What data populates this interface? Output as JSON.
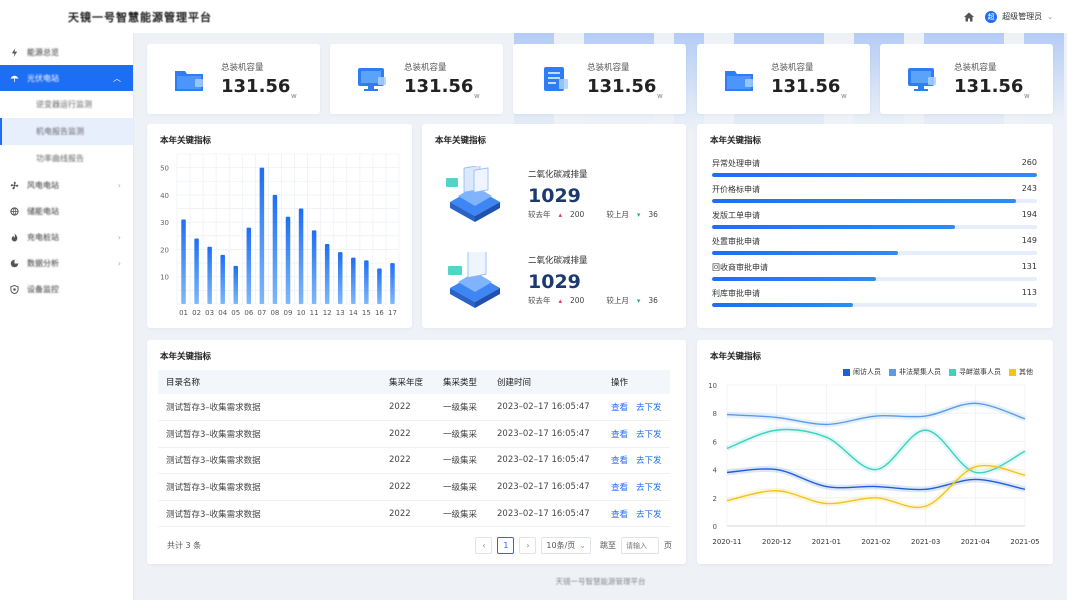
{
  "app": {
    "title": "天镜一号智慧能源管理平台",
    "user": "超级管理员",
    "avatar_letter": "超",
    "footer": "天镜一号智慧能源管理平台"
  },
  "sidebar": {
    "items": [
      {
        "label": "能源总览",
        "icon": "bolt-icon",
        "expandable": false
      },
      {
        "label": "光伏电站",
        "icon": "umbrella-icon",
        "expandable": true,
        "active": true,
        "children": [
          {
            "label": "逆变器运行监测"
          },
          {
            "label": "机电报告监测",
            "active": true
          },
          {
            "label": "功率曲线报告"
          }
        ]
      },
      {
        "label": "风电电站",
        "icon": "fan-icon",
        "expandable": true
      },
      {
        "label": "储能电站",
        "icon": "globe-icon",
        "expandable": false
      },
      {
        "label": "充电桩站",
        "icon": "flame-icon",
        "expandable": true
      },
      {
        "label": "数据分析",
        "icon": "chart-icon",
        "expandable": true
      },
      {
        "label": "设备监控",
        "icon": "shield-icon",
        "expandable": false
      }
    ]
  },
  "stats": [
    {
      "label": "总装机容量",
      "value": "131.56",
      "unit": "w",
      "icon": "folder-icon"
    },
    {
      "label": "总装机容量",
      "value": "131.56",
      "unit": "w",
      "icon": "monitor-icon"
    },
    {
      "label": "总装机容量",
      "value": "131.56",
      "unit": "w",
      "icon": "document-icon"
    },
    {
      "label": "总装机容量",
      "value": "131.56",
      "unit": "w",
      "icon": "folder-icon"
    },
    {
      "label": "总装机容量",
      "value": "131.56",
      "unit": "w",
      "icon": "monitor-icon"
    }
  ],
  "bar_panel": {
    "title": "本年关键指标"
  },
  "co2_panel": {
    "title": "本年关键指标",
    "rows": [
      {
        "label": "二氧化碳减排量",
        "value": "1029",
        "yoy_label": "较去年",
        "yoy": "200",
        "mom_label": "较上月",
        "mom": "36"
      },
      {
        "label": "二氧化碳减排量",
        "value": "1029",
        "yoy_label": "较去年",
        "yoy": "200",
        "mom_label": "较上月",
        "mom": "36"
      }
    ]
  },
  "progress_panel": {
    "title": "本年关键指标",
    "items": [
      {
        "label": "异常处理申请",
        "value": 260
      },
      {
        "label": "开价格标申请",
        "value": 243
      },
      {
        "label": "发版工单申请",
        "value": 194
      },
      {
        "label": "处置审批申请",
        "value": 149
      },
      {
        "label": "回收商审批申请",
        "value": 131
      },
      {
        "label": "利库审批申请",
        "value": 113
      }
    ],
    "max": 260
  },
  "table_panel": {
    "title": "本年关键指标",
    "columns": [
      "目录名称",
      "集采年度",
      "集采类型",
      "创建时间",
      "操作"
    ],
    "rows": [
      [
        "测试暂存3–收集需求数据",
        "2022",
        "一级集采",
        "2023–02–17 16:05:47"
      ],
      [
        "测试暂存3–收集需求数据",
        "2022",
        "一级集采",
        "2023–02–17 16:05:47"
      ],
      [
        "测试暂存3–收集需求数据",
        "2022",
        "一级集采",
        "2023–02–17 16:05:47"
      ],
      [
        "测试暂存3–收集需求数据",
        "2022",
        "一级集采",
        "2023–02–17 16:05:47"
      ],
      [
        "测试暂存3–收集需求数据",
        "2022",
        "一级集采",
        "2023–02–17 16:05:47"
      ]
    ],
    "actions": {
      "view": "查看",
      "issue": "去下发"
    },
    "pager": {
      "total": "共计 3 条",
      "current": "1",
      "prev": "‹",
      "next": "›",
      "size": "10条/页",
      "jump": "跳至",
      "placeholder": "请输入",
      "page_unit": "页"
    }
  },
  "line_panel": {
    "title": "本年关键指标"
  },
  "chart_data": [
    {
      "type": "bar",
      "categories": [
        "01",
        "02",
        "03",
        "04",
        "05",
        "06",
        "07",
        "08",
        "09",
        "10",
        "11",
        "12",
        "13",
        "14",
        "15",
        "16",
        "17"
      ],
      "values": [
        31,
        24,
        21,
        18,
        14,
        28,
        50,
        40,
        32,
        35,
        27,
        22,
        19,
        17,
        16,
        13,
        15
      ],
      "ylim": [
        0,
        55
      ],
      "yticks": [
        10,
        20,
        30,
        40,
        50
      ],
      "grid": true,
      "color": "#1e6ef5"
    },
    {
      "type": "line",
      "x": [
        "2020-11",
        "2020-12",
        "2021-01",
        "2021-02",
        "2021-03",
        "2021-04",
        "2021-05"
      ],
      "ylim": [
        0,
        10
      ],
      "yticks": [
        0,
        2,
        4,
        6,
        8,
        10
      ],
      "legend_position": "top-right",
      "series": [
        {
          "name": "闹访人员",
          "color": "#1e5fd8",
          "values": [
            3.8,
            4.0,
            2.8,
            2.8,
            2.6,
            3.3,
            2.6
          ]
        },
        {
          "name": "非法聚集人员",
          "color": "#5a9be8",
          "values": [
            7.9,
            7.7,
            7.2,
            7.8,
            7.8,
            8.7,
            7.6
          ]
        },
        {
          "name": "寻衅滋事人员",
          "color": "#3fd0c0",
          "values": [
            5.5,
            6.8,
            6.3,
            4.0,
            6.8,
            3.8,
            5.3
          ]
        },
        {
          "name": "其他",
          "color": "#f0c419",
          "values": [
            1.8,
            2.5,
            1.6,
            2.0,
            1.4,
            4.2,
            3.6
          ]
        }
      ]
    }
  ]
}
